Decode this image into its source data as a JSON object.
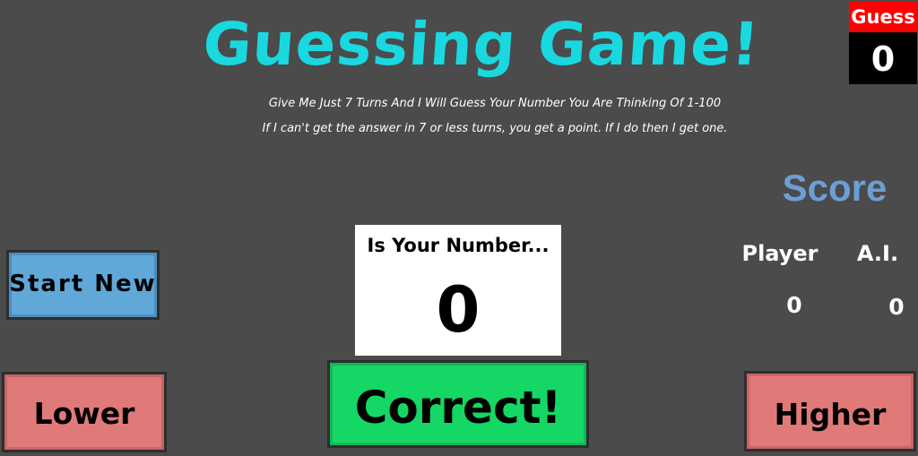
{
  "header": {
    "title": "Guessing Game!",
    "subtitle_line1": "Give Me Just 7 Turns And I Will Guess Your Number You Are Thinking Of 1-100",
    "subtitle_line2": "If I can't get the answer in 7 or less turns, you get a point. If I do then I get one."
  },
  "guess_counter": {
    "label": "Guess",
    "value": "0"
  },
  "score": {
    "title": "Score",
    "player_label": "Player",
    "ai_label": "A.I.",
    "player_value": "0",
    "ai_value": "0"
  },
  "question": {
    "caption": "Is Your Number...",
    "value": "0"
  },
  "buttons": {
    "start_new": "Start New",
    "lower": "Lower",
    "correct": "Correct!",
    "higher": "Higher"
  },
  "colors": {
    "background": "#4b4b4b",
    "title": "#1ad8e0",
    "score_title": "#6c9fd4",
    "guess_label_bg": "#ff0000",
    "start_button": "#5fa8d8",
    "lower_higher_button": "#e07a78",
    "correct_button": "#14d766"
  }
}
